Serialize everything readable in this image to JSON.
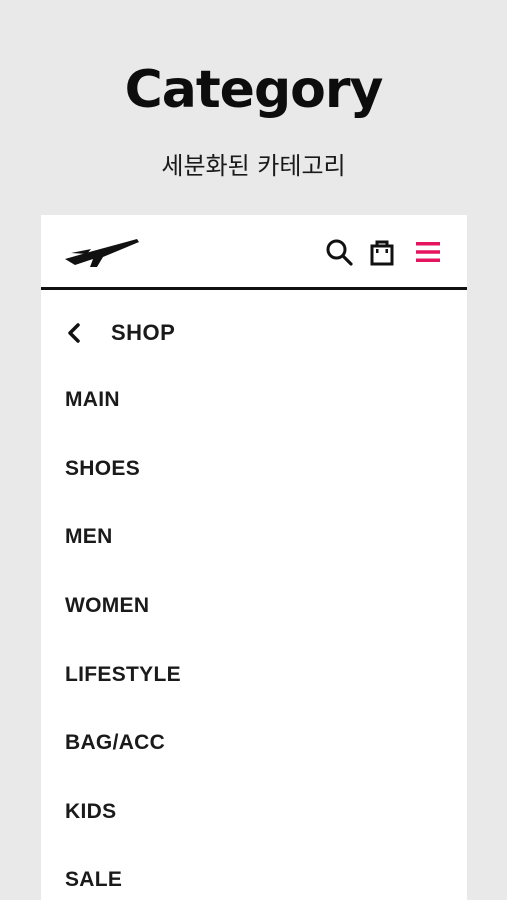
{
  "hero": {
    "title": "Category",
    "subtitle": "세분화된 카테고리"
  },
  "header": {
    "logo_icon": "swoosh-wing-logo",
    "icons": [
      "search-icon",
      "shopping-bag-icon",
      "hamburger-menu-icon"
    ],
    "accent_color": "#e6135e"
  },
  "menu": {
    "back_label": "SHOP",
    "items": [
      {
        "label": "MAIN"
      },
      {
        "label": "SHOES"
      },
      {
        "label": "MEN"
      },
      {
        "label": "WOMEN"
      },
      {
        "label": "LIFESTYLE"
      },
      {
        "label": "BAG/ACC"
      },
      {
        "label": "KIDS"
      },
      {
        "label": "SALE"
      }
    ]
  }
}
